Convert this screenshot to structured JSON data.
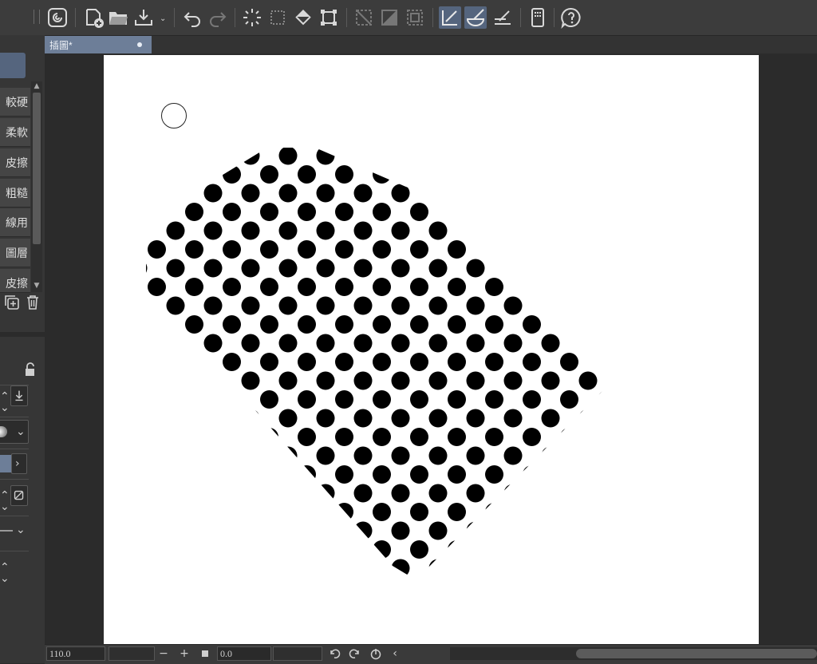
{
  "document": {
    "tab_title": "插圖*"
  },
  "toolbar": {
    "buttons": [
      {
        "name": "clip-studio-icon"
      },
      {
        "name": "new-canvas-icon"
      },
      {
        "name": "open-folder-icon"
      },
      {
        "name": "export-icon"
      },
      {
        "name": "undo-icon"
      },
      {
        "name": "redo-icon"
      },
      {
        "name": "select-all-icon"
      },
      {
        "name": "clear-selection-icon"
      },
      {
        "name": "fill-bucket-icon"
      },
      {
        "name": "transform-icon"
      },
      {
        "name": "hatch-frame-icon"
      },
      {
        "name": "diagonal-frame-icon"
      },
      {
        "name": "border-frame-icon"
      },
      {
        "name": "ruler-snap-icon"
      },
      {
        "name": "brush-snap-icon"
      },
      {
        "name": "line-snap-icon"
      },
      {
        "name": "device-icon"
      },
      {
        "name": "help-icon"
      }
    ]
  },
  "subtool": {
    "items": [
      "較硬",
      "柔軟",
      "皮擦",
      "粗糙",
      "線用",
      "圖層",
      "皮擦"
    ]
  },
  "statusbar": {
    "zoom": "110.0",
    "rotation": "0.0",
    "zoom_out": "−",
    "zoom_in": "+"
  },
  "colors": {
    "accent": "#55657e",
    "tab": "#6d7e98",
    "canvas_bg": "#ffffff",
    "dot": "#000000"
  }
}
